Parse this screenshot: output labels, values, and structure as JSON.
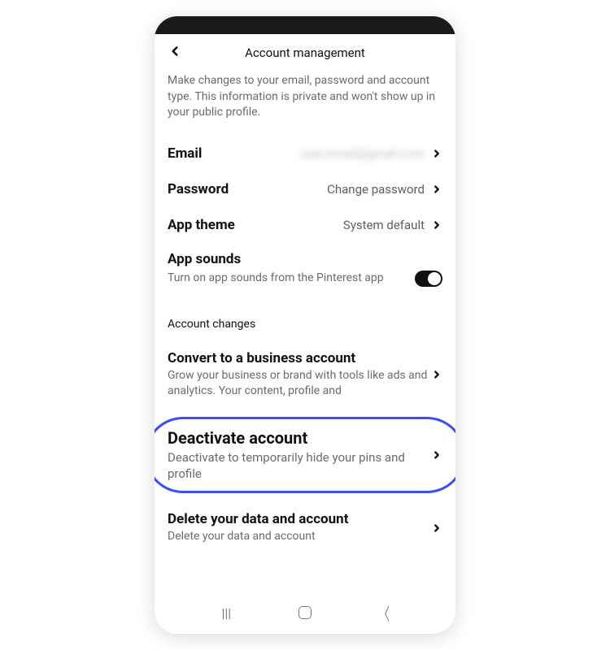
{
  "header": {
    "title": "Account management"
  },
  "intro": "Make changes to your email, password and account type. This information is private and won't show up in your public profile.",
  "rows": {
    "email": {
      "label": "Email",
      "value": "user.email@gmail.com"
    },
    "password": {
      "label": "Password",
      "value": "Change password"
    },
    "theme": {
      "label": "App theme",
      "value": "System default"
    }
  },
  "sounds": {
    "title": "App sounds",
    "desc": "Turn on app sounds from the Pinterest app",
    "on": true
  },
  "section_label": "Account changes",
  "changes": {
    "convert": {
      "title": "Convert to a business account",
      "desc": "Grow your business or brand with tools like ads and analytics. Your content, profile and"
    },
    "deactivate": {
      "title": "Deactivate account",
      "desc": "Deactivate to temporarily hide your pins and profile"
    },
    "delete": {
      "title": "Delete your data and account",
      "desc": "Delete your data and account"
    }
  }
}
